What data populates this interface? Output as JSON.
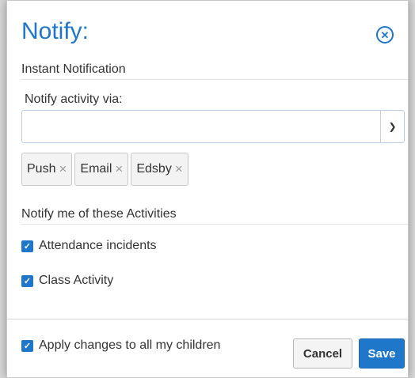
{
  "dialog": {
    "title": "Notify:",
    "close_icon": "close-circle-icon"
  },
  "instant": {
    "section_label": "Instant Notification",
    "field_label": "Notify activity via:",
    "select_value": "",
    "tags": [
      {
        "label": "Push"
      },
      {
        "label": "Email"
      },
      {
        "label": "Edsby"
      }
    ],
    "remove_glyph": "×"
  },
  "activities": {
    "section_label": "Notify me of these Activities",
    "items": [
      {
        "label": "Attendance incidents",
        "checked": true
      },
      {
        "label": "Class Activity",
        "checked": true
      }
    ]
  },
  "footer": {
    "apply_all_label": "Apply changes to all my children",
    "apply_all_checked": true,
    "cancel_label": "Cancel",
    "save_label": "Save"
  },
  "colors": {
    "accent": "#1f77c9"
  }
}
